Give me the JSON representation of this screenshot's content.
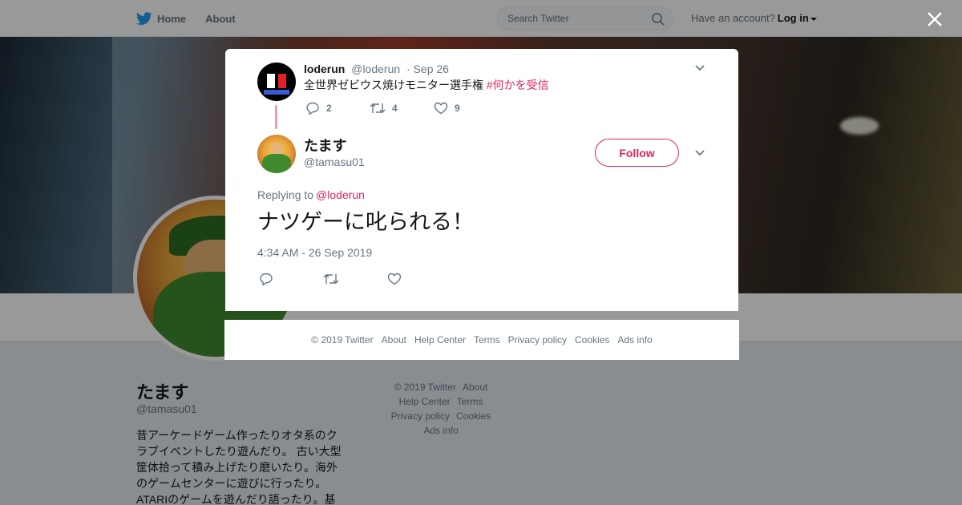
{
  "nav": {
    "home_label": "Home",
    "about_label": "About",
    "search_placeholder": "Search Twitter",
    "have_account": "Have an account?",
    "login_label": "Log in"
  },
  "profile": {
    "name": "たます",
    "handle": "@tamasu01",
    "bio": "昔アーケードゲーム作ったりオタ系のクラブイベントしたり遊んだり。 古い大型筐体拾って積み上げたり磨いたり。海外のゲームセンターに遊びに行ったり。ATARIのゲームを遊んだり語ったり。基"
  },
  "side_footer": {
    "copyright": "© 2019 Twitter",
    "about": "About",
    "help": "Help Center",
    "terms": "Terms",
    "privacy": "Privacy policy",
    "cookies": "Cookies",
    "ads": "Ads info"
  },
  "parent_tweet": {
    "name": "loderun",
    "handle": "@loderun",
    "date": "· Sep 26",
    "text": "全世界ゼビウス焼けモニター選手権 ",
    "hashtag": "#何かを受信",
    "reply_count": "2",
    "retweet_count": "4",
    "like_count": "9"
  },
  "main_tweet": {
    "name": "たます",
    "handle": "@tamasu01",
    "follow_label": "Follow",
    "replying_to_label": "Replying to",
    "replying_to_handle": "@loderun",
    "text": "ナツゲーに叱られる！",
    "timestamp": "4:34 AM - 26 Sep 2019"
  },
  "modal_footer": {
    "copyright": "© 2019 Twitter",
    "about": "About",
    "help": "Help Center",
    "terms": "Terms",
    "privacy": "Privacy policy",
    "cookies": "Cookies",
    "ads": "Ads info"
  },
  "colors": {
    "accent": "#e0245e",
    "twitter_blue": "#1da1f2",
    "secondary_text": "#657786"
  },
  "icons": [
    "twitter-bird-icon",
    "search-icon",
    "close-icon",
    "chevron-down-icon",
    "reply-icon",
    "retweet-icon",
    "like-icon"
  ]
}
